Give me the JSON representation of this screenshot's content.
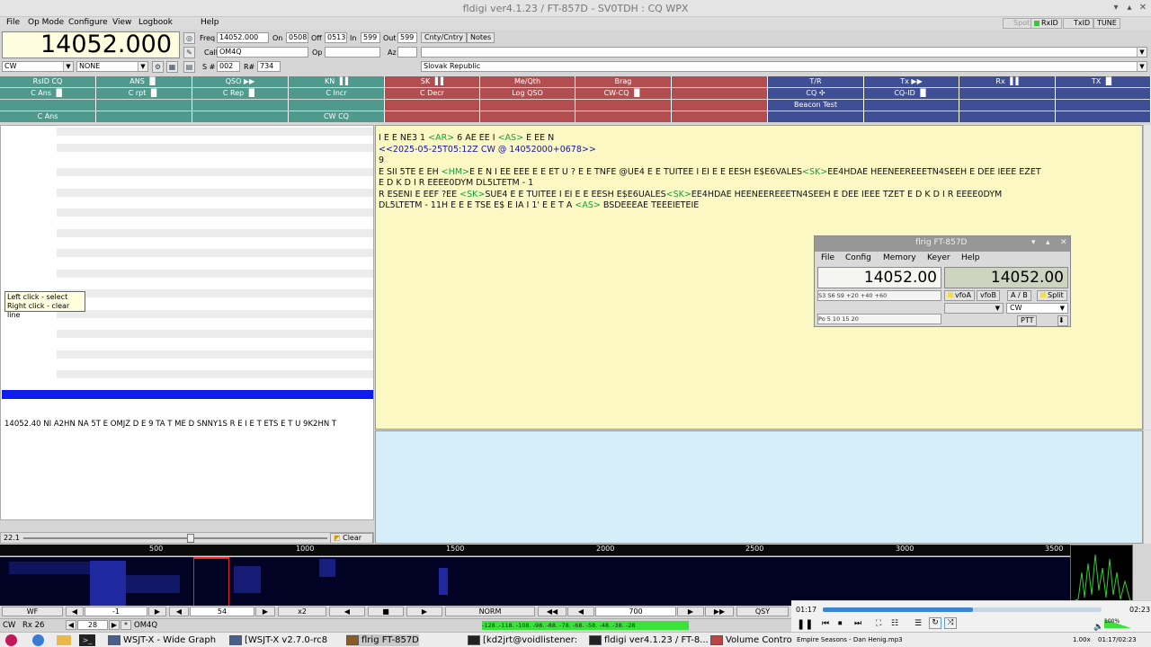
{
  "window": {
    "title": "fldigi ver4.1.23 / FT-857D - SV0TDH : CQ WPX"
  },
  "menu": {
    "items": [
      "File",
      "Op Mode",
      "Configure",
      "View",
      "Logbook",
      "Help"
    ]
  },
  "toggles": {
    "spot": "Spot",
    "rxid": "RxID",
    "txid": "TxID",
    "tune": "TUNE"
  },
  "qso": {
    "freq_display": "14052.000",
    "freq_label": "Freq",
    "freq": "14052.000",
    "on_label": "On",
    "on": "0508",
    "off_label": "Off",
    "off": "0513",
    "in_label": "In",
    "in": "599",
    "out_label": "Out",
    "out": "599",
    "cnty_btn": "Cnty/Cntry",
    "notes_btn": "Notes",
    "call_label": "Call",
    "call": "OM4Q",
    "op_label": "Op",
    "op": "",
    "az_label": "Az",
    "az": "",
    "snum_label": "S #",
    "snum": "002",
    "rnum_label": "R#",
    "rnum": "734",
    "mode": "CW",
    "bw": "NONE",
    "country": "Slovak Republic"
  },
  "macros": {
    "row1": [
      "RsID CQ",
      "ANS ▐▌",
      "QSO ▶▶",
      "KN ▐▐",
      "SK ▐▐",
      "Me/Qth",
      "Brag",
      "",
      "T/R",
      "Tx ▶▶",
      "Rx ▐▐",
      "TX ▐▌"
    ],
    "row2": [
      "C Ans ▐▌",
      "C rpt ▐▌",
      "C Rep ▐▌",
      "C Incr",
      "C Decr",
      "Log QSO",
      "CW-CQ ▐▌",
      "",
      "CQ ✣",
      "CQ-ID ▐▌",
      "",
      ""
    ],
    "row3": [
      "",
      "",
      "",
      "",
      "",
      "",
      "",
      "",
      "Beacon Test",
      "",
      "",
      ""
    ],
    "row4": [
      "C Ans",
      "",
      "",
      "CW CQ",
      "",
      "",
      "",
      "",
      "",
      "",
      "",
      ""
    ]
  },
  "tooltip": {
    "line1": "Left click - select",
    "line2": "Right click - clear line"
  },
  "browser_line": "14052.40  NI A2HN NA 5T E OMJZ D E 9 TA T ME D SNNY1S R E I E T ETS E T U 9K2HN T",
  "slider": {
    "value": "22.1",
    "clear": "Clear"
  },
  "rx": {
    "l1": [
      {
        "t": "I E E NE3 1 ",
        "c": ""
      },
      {
        "t": "<AR>",
        "c": "tg"
      },
      {
        "t": " 6 AE EE I ",
        "c": ""
      },
      {
        "t": "<AS>",
        "c": "tg"
      },
      {
        "t": " E EE N",
        "c": ""
      }
    ],
    "l2": [
      {
        "t": "<<2025-05-25T05:12Z CW @ 14052000+0678>>",
        "c": "hd"
      }
    ],
    "l3": [
      {
        "t": "9",
        "c": ""
      }
    ],
    "l4": [
      {
        "t": "E SII 5TE E EH ",
        "c": ""
      },
      {
        "t": "<HM>",
        "c": "tg"
      },
      {
        "t": "E E N I EE EEE E E ET U ? E E TNFE @UE4 E E TÜITEE I EI E E EESH E$E6VALES",
        "c": ""
      },
      {
        "t": "<SK>",
        "c": "tg"
      },
      {
        "t": "EE4HDAE HEENEEREEETN4SEEH E DEE IEEE EZET",
        "c": ""
      }
    ],
    "l5": [
      {
        "t": "E D K D I R EEEE0DYM DL5LTETM - 1",
        "c": ""
      }
    ],
    "l6": [
      {
        "t": "R ESENI E EEF ?EE ",
        "c": ""
      },
      {
        "t": "<SK>",
        "c": "tg"
      },
      {
        "t": "SUE4 E E TÜITEE I EI E E EESH E$E6UALES",
        "c": ""
      },
      {
        "t": "<SK>",
        "c": "tg"
      },
      {
        "t": "EE4HDAE HEENEEREEETN4SEEH E DEE IEEE TZET E D K D I R EEEE0DYM",
        "c": ""
      }
    ],
    "l7": [
      {
        "t": "DL5LTETM - 11H E E E TSE E$ E IA I 1' E E T A ",
        "c": ""
      },
      {
        "t": "<AS>",
        "c": "tg"
      },
      {
        "t": " BSDEEEAE TEEEIETEIE",
        "c": ""
      }
    ]
  },
  "flrig": {
    "title": "flrig FT-857D",
    "menu": [
      "File",
      "Config",
      "Memory",
      "Keyer",
      "Help"
    ],
    "vfoa": "14052.00",
    "vfob": "14052.00",
    "smeter_scale": "  S3    S6    S9   +20  +40  +60",
    "power_scale": "Po     5      10     15     20",
    "btn_vfoa": "vfoA",
    "btn_vfob": "vfoB",
    "btn_ab": "A / B",
    "btn_split": "Split",
    "mode": "CW",
    "ptt": "PTT"
  },
  "waterfall": {
    "ticks": [
      "500",
      "1000",
      "1500",
      "2000",
      "2500",
      "3000",
      "3500"
    ],
    "wf_btn": "WF",
    "offset": "-1",
    "level": "54",
    "x2": "x2",
    "norm": "NORM",
    "freq": "700",
    "qsy": "QSY"
  },
  "status": {
    "mode": "CW",
    "rx": "Rx 26",
    "wpm": "28",
    "call": "OM4Q",
    "dbscale": "-128 .-118. -108. -98. -88. -78. -68. -58. -48. -38. -28"
  },
  "player": {
    "elapsed": "01:17",
    "total": "02:23",
    "progress": 0.54,
    "track": "Empire Seasons - Dan Henig.mp3",
    "volume": "100%",
    "speed": "1.00x",
    "time": "01:17/02:23"
  },
  "taskbar": {
    "items": [
      "WSJT-X - Wide Graph",
      "[WSJT-X   v2.7.0-rc8",
      "flrig FT-857D",
      "[kd2jrt@voidlistener:",
      "fldigi ver4.1.23 / FT-8...",
      "Volume Contro"
    ]
  }
}
